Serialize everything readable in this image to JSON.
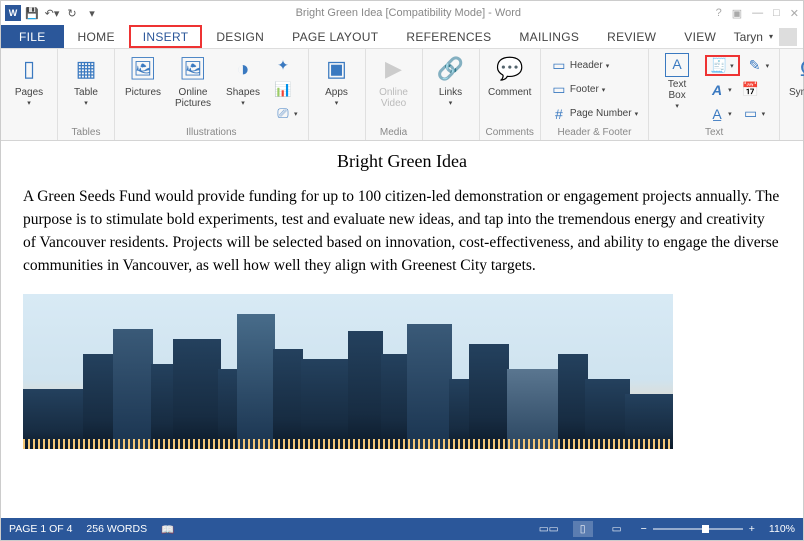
{
  "titlebar": {
    "title": "Bright Green Idea [Compatibility Mode] - Word"
  },
  "tabs": {
    "file": "FILE",
    "items": [
      "HOME",
      "INSERT",
      "DESIGN",
      "PAGE LAYOUT",
      "REFERENCES",
      "MAILINGS",
      "REVIEW",
      "VIEW"
    ],
    "active": "INSERT",
    "user": "Taryn"
  },
  "ribbon": {
    "pages": {
      "label": "Pages"
    },
    "tables": {
      "btn": "Table",
      "group": "Tables"
    },
    "illus": {
      "pictures": "Pictures",
      "online_pictures": "Online\nPictures",
      "shapes": "Shapes",
      "group": "Illustrations"
    },
    "apps": {
      "label": "Apps"
    },
    "media": {
      "label": "Online\nVideo",
      "group": "Media"
    },
    "links": {
      "label": "Links"
    },
    "comments": {
      "btn": "Comment",
      "group": "Comments"
    },
    "hf": {
      "header": "Header",
      "footer": "Footer",
      "pagenum": "Page Number",
      "group": "Header & Footer"
    },
    "text": {
      "textbox": "Text\nBox",
      "group": "Text"
    },
    "symbols": {
      "label": "Symbols"
    }
  },
  "document": {
    "title": "Bright Green Idea",
    "body": "A Green Seeds Fund would provide funding for up to 100 citizen-led demonstration or engagement projects annually. The purpose is to stimulate bold experiments, test and evaluate new ideas, and tap into the tremendous energy and creativity of Vancouver residents. Projects will be selected based on innovation, cost-effectiveness, and ability to engage the diverse communities in Vancouver, as well how well they align with Greenest City targets."
  },
  "statusbar": {
    "page": "PAGE 1 OF 4",
    "words": "256 WORDS",
    "zoom": "110%"
  }
}
